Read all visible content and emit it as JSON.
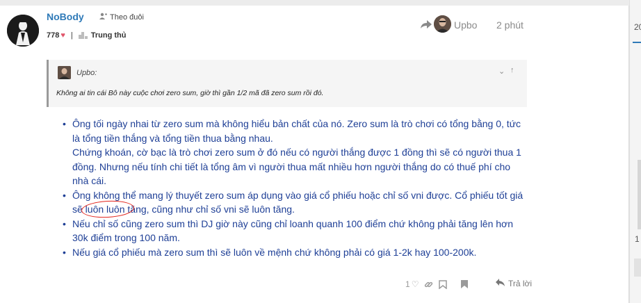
{
  "post": {
    "username": "NoBody",
    "follow_label": "Theo đuôi",
    "reputation": "778",
    "rank": "Trung thủ",
    "reply_to_user": "Upbo",
    "time_ago": "2 phút"
  },
  "quote": {
    "author": "Upbo:",
    "text": "Không ai tin cái Bô này cuộc chơi zero sum, giờ thì gần 1/2 mã đã zero sum rồi đó."
  },
  "body": [
    [
      "Ông tối ngày nhai từ zero sum mà không hiểu bản chất của nó. Zero sum là trò chơi có tổng bằng 0, tức",
      "là tổng tiền thắng và tổng tiền thua bằng nhau.",
      "Chứng khoán, cờ bạc là trò chơi zero sum ở đó nếu có người thắng được 1 đồng thì sẽ có người thua 1",
      "đồng. Nhưng nếu tính chi tiết là tổng âm vì người thua mất nhiều hơn người thắng do có thuế phí cho",
      "nhà cái."
    ],
    [
      "Ông không thể mang lý thuyết zero sum áp dụng vào giá cổ phiếu hoặc chỉ số vni được. Cổ phiếu tốt giá",
      "sẽ luôn luôn tăng, cũng như chỉ số vni sẽ luôn tăng."
    ],
    [
      "Nếu chỉ số cũng zero sum thì DJ giờ này cũng chỉ loanh quanh 100 điểm chứ không phải tăng lên hơn",
      "30k điểm trong 100 năm."
    ],
    [
      "Nếu giá cổ phiếu mà zero sum thì sẽ luôn về mệnh chứ không phải có giá 1-2k hay 100-200k."
    ]
  ],
  "footer": {
    "like_count": "1",
    "reply_label": "Trả lời"
  },
  "side": {
    "frag1": "20",
    "frag2": "1"
  },
  "colors": {
    "username": "#2f7ab8",
    "body_text": "#1e3f96",
    "heart": "#e0566b",
    "annotation_circle": "#e2231a"
  },
  "icons": [
    "follow-user-icon",
    "heart-icon",
    "rank-icon",
    "share-icon",
    "chevron-down-icon",
    "arrow-up-icon",
    "like-icon",
    "link-icon",
    "bookmark-icon",
    "flag-icon",
    "reply-icon"
  ]
}
